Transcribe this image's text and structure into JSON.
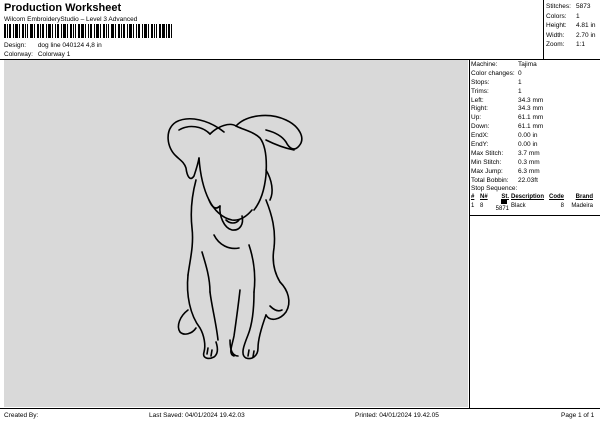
{
  "header": {
    "title": "Production Worksheet",
    "subtitle": "Wilcom EmbroideryStudio – Level 3 Advanced"
  },
  "design_info": {
    "design_label": "Design:",
    "design_value": "dog line 040124 4,8 in",
    "colorway_label": "Colorway:",
    "colorway_value": "Colorway 1"
  },
  "stats": [
    {
      "label": "Stitches:",
      "value": "5873"
    },
    {
      "label": "Colors:",
      "value": "1"
    },
    {
      "label": "Height:",
      "value": "4.81 in"
    },
    {
      "label": "Width:",
      "value": "2.70 in"
    },
    {
      "label": "Zoom:",
      "value": "1:1"
    }
  ],
  "machine_info": [
    {
      "label": "Machine:",
      "value": "Tajima"
    },
    {
      "label": "Color changes:",
      "value": "0"
    },
    {
      "label": "Stops:",
      "value": "1"
    },
    {
      "label": "Trims:",
      "value": "1"
    },
    {
      "label": "Left:",
      "value": "34.3 mm"
    },
    {
      "label": "Right:",
      "value": "34.3 mm"
    },
    {
      "label": "Up:",
      "value": "61.1 mm"
    },
    {
      "label": "Down:",
      "value": "61.1 mm"
    },
    {
      "label": "EndX:",
      "value": "0.00 in"
    },
    {
      "label": "EndY:",
      "value": "0.00 in"
    },
    {
      "label": "Max Stitch:",
      "value": "3.7 mm"
    },
    {
      "label": "Min Stitch:",
      "value": "0.3 mm"
    },
    {
      "label": "Max Jump:",
      "value": "6.3 mm"
    },
    {
      "label": "Total Bobbin:",
      "value": "22.03ft"
    }
  ],
  "stop_sequence": {
    "title": "Stop Sequence:",
    "headers": [
      "#",
      "N#",
      "St.",
      "Description",
      "Code",
      "Brand"
    ],
    "rows": [
      {
        "num": "1",
        "needle": "8",
        "stitches": "5871",
        "description": "Black",
        "code": "8",
        "brand": "Madeira",
        "swatch_color": "#000000"
      }
    ]
  },
  "footer": {
    "created_by": "Created By:",
    "last_saved": "Last Saved: 04/01/2024 19.42.03",
    "printed": "Printed: 04/01/2024 19.42.05",
    "page": "Page 1 of 1"
  },
  "colors": {
    "design_background": "#d9d9d9",
    "thread": "#000000"
  }
}
